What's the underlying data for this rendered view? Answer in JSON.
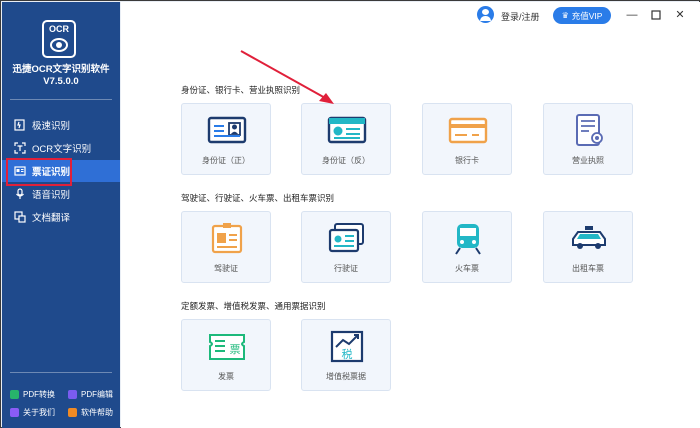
{
  "app": {
    "logo_text": "OCR",
    "name_line1": "迅捷OCR文字识别软件",
    "version": "V7.5.0.0"
  },
  "sidebar": {
    "items": [
      {
        "label": "极速识别",
        "icon": "flash-icon"
      },
      {
        "label": "OCR文字识别",
        "icon": "ocr-text-icon"
      },
      {
        "label": "票证识别",
        "icon": "ticket-icon",
        "active": true
      },
      {
        "label": "语音识别",
        "icon": "microphone-icon"
      },
      {
        "label": "文档翻译",
        "icon": "translate-icon"
      }
    ],
    "bottom": [
      {
        "label": "PDF转换",
        "color": "#27b36b"
      },
      {
        "label": "PDF编辑",
        "color": "#7a5cf0"
      },
      {
        "label": "关于我们",
        "color": "#8b5cf6"
      },
      {
        "label": "软件帮助",
        "color": "#f08a24"
      }
    ]
  },
  "topbar": {
    "login_label": "登录/注册",
    "vip_label": "充值VIP",
    "vip_icon": "♛",
    "minimize": "—",
    "close": "✕"
  },
  "sections": [
    {
      "title": "身份证、银行卡、营业执照识别",
      "cards": [
        {
          "label": "身份证（正）",
          "icon": "id-card-front-icon"
        },
        {
          "label": "身份证（反）",
          "icon": "id-card-back-icon"
        },
        {
          "label": "银行卡",
          "icon": "bank-card-icon"
        },
        {
          "label": "营业执照",
          "icon": "business-license-icon"
        }
      ]
    },
    {
      "title": "驾驶证、行驶证、火车票、出租车票识别",
      "cards": [
        {
          "label": "驾驶证",
          "icon": "driver-license-icon"
        },
        {
          "label": "行驶证",
          "icon": "vehicle-license-icon"
        },
        {
          "label": "火车票",
          "icon": "train-icon"
        },
        {
          "label": "出租车票",
          "icon": "taxi-icon"
        }
      ]
    },
    {
      "title": "定额发票、增值税发票、通用票据识别",
      "cards": [
        {
          "label": "发票",
          "icon": "invoice-icon",
          "glyph": "票"
        },
        {
          "label": "增值税票据",
          "icon": "vat-invoice-icon",
          "glyph": "税"
        }
      ]
    }
  ],
  "colors": {
    "sidebar_bg": "#1f4a8c",
    "accent": "#2a7ce8",
    "highlight_outline": "#e0203a"
  }
}
